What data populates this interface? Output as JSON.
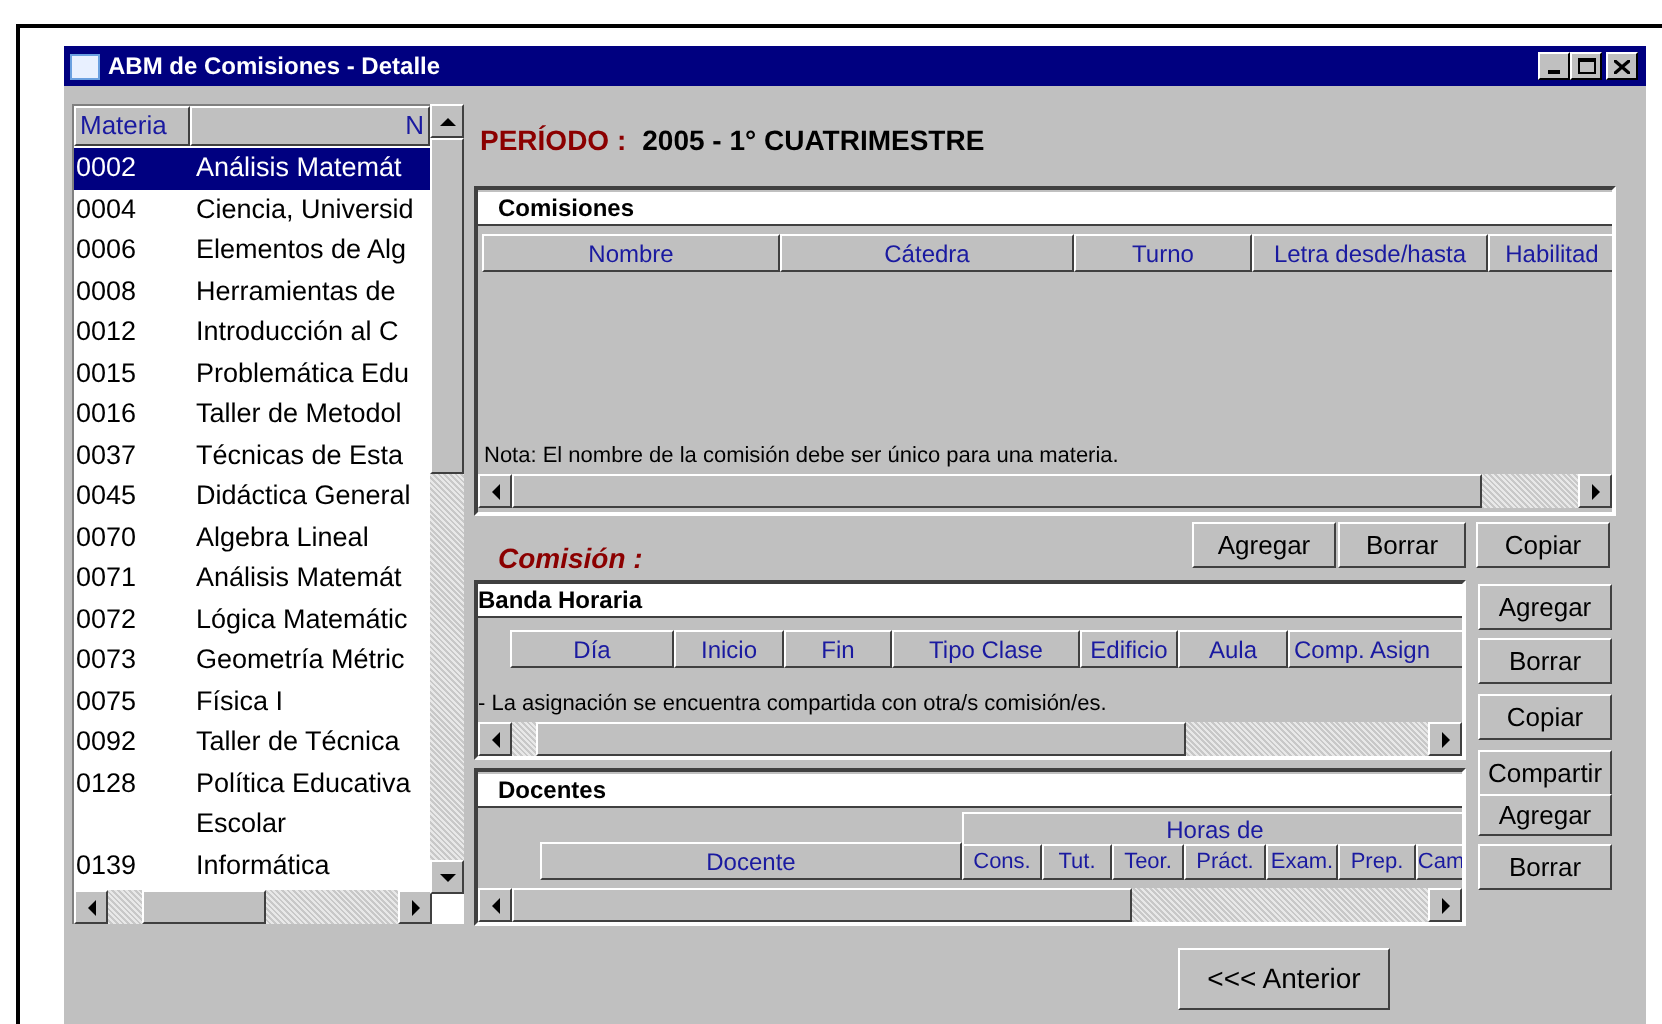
{
  "window": {
    "title": "ABM de Comisiones - Detalle"
  },
  "materias": {
    "columns": [
      "Materia",
      "N"
    ],
    "rows": [
      {
        "code": "0002",
        "name": "Análisis Matemát",
        "selected": true
      },
      {
        "code": "0004",
        "name": "Ciencia, Universid",
        "selected": false
      },
      {
        "code": "0006",
        "name": "Elementos de Alg",
        "selected": false
      },
      {
        "code": "0008",
        "name": "Herramientas de",
        "selected": false
      },
      {
        "code": "0012",
        "name": "Introducción al C",
        "selected": false
      },
      {
        "code": "0015",
        "name": "Problemática Edu",
        "selected": false
      },
      {
        "code": "0016",
        "name": "Taller de Metodol",
        "selected": false
      },
      {
        "code": "0037",
        "name": "Técnicas de Esta",
        "selected": false
      },
      {
        "code": "0045",
        "name": "Didáctica General",
        "selected": false
      },
      {
        "code": "0070",
        "name": "Algebra Lineal",
        "selected": false
      },
      {
        "code": "0071",
        "name": "Análisis Matemát",
        "selected": false
      },
      {
        "code": "0072",
        "name": "Lógica Matemátic",
        "selected": false
      },
      {
        "code": "0073",
        "name": "Geometría Métric",
        "selected": false
      },
      {
        "code": "0075",
        "name": "Física I",
        "selected": false
      },
      {
        "code": "0092",
        "name": "Taller de Técnica",
        "selected": false
      },
      {
        "code": "0128",
        "name": "Política Educativa Escolar",
        "selected": false
      },
      {
        "code": "0139",
        "name": "Informática",
        "selected": false
      }
    ]
  },
  "periodo": {
    "label": "PERÍODO :",
    "value": "2005 - 1° CUATRIMESTRE"
  },
  "comisiones": {
    "title": "Comisiones",
    "columns": [
      "Nombre",
      "Cátedra",
      "Turno",
      "Letra desde/hasta",
      "Habilitad"
    ],
    "note": "Nota: El nombre de la comisión debe ser único para una materia."
  },
  "comisiones_buttons": [
    "Agregar",
    "Borrar",
    "Copiar"
  ],
  "comision": {
    "label": "Comisión :"
  },
  "banda_horaria": {
    "title": "Banda Horaria",
    "columns": [
      "Día",
      "Inicio",
      "Fin",
      "Tipo Clase",
      "Edificio",
      "Aula",
      "Comp. Asign"
    ],
    "note": "- La asignación se encuentra compartida con otra/s comisión/es."
  },
  "banda_buttons": [
    "Agregar",
    "Borrar",
    "Copiar",
    "Compartir"
  ],
  "docentes": {
    "title": "Docentes",
    "columns": [
      "Docente"
    ],
    "group_label": "Horas de",
    "group_columns": [
      "Cons.",
      "Tut.",
      "Teor.",
      "Práct.",
      "Exam.",
      "Prep.",
      "Cam"
    ]
  },
  "docentes_buttons": [
    "Agregar",
    "Borrar"
  ],
  "anterior_button": "<<< Anterior"
}
